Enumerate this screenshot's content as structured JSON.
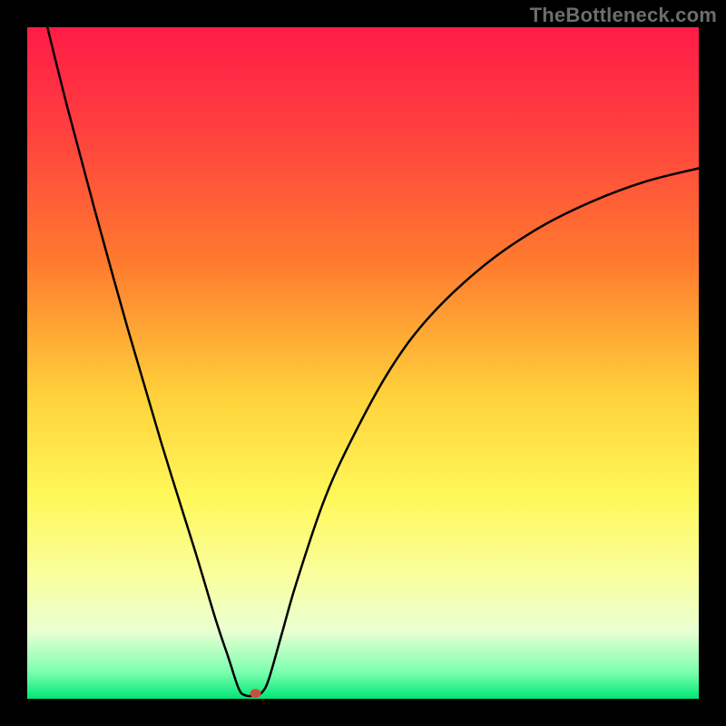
{
  "watermark": "TheBottleneck.com",
  "chart_data": {
    "type": "line",
    "title": "",
    "xlabel": "",
    "ylabel": "",
    "xlim": [
      0,
      100
    ],
    "ylim": [
      0,
      100
    ],
    "background_gradient": {
      "stops": [
        {
          "offset": 0.0,
          "color": "#ff1b47"
        },
        {
          "offset": 0.15,
          "color": "#ff3f3f"
        },
        {
          "offset": 0.35,
          "color": "#ff7a2f"
        },
        {
          "offset": 0.55,
          "color": "#ffd23a"
        },
        {
          "offset": 0.7,
          "color": "#fff85a"
        },
        {
          "offset": 0.82,
          "color": "#f9ffa0"
        },
        {
          "offset": 0.9,
          "color": "#e8ffd2"
        },
        {
          "offset": 0.96,
          "color": "#7dffb0"
        },
        {
          "offset": 1.0,
          "color": "#00e676"
        }
      ]
    },
    "series": [
      {
        "name": "bottleneck-curve",
        "color": "#000000",
        "stroke_width": 2.5,
        "points": [
          {
            "x": 3.0,
            "y": 100.0
          },
          {
            "x": 6.0,
            "y": 88.0
          },
          {
            "x": 10.0,
            "y": 73.0
          },
          {
            "x": 15.0,
            "y": 55.0
          },
          {
            "x": 20.0,
            "y": 38.0
          },
          {
            "x": 25.0,
            "y": 22.0
          },
          {
            "x": 28.0,
            "y": 12.0
          },
          {
            "x": 30.0,
            "y": 6.0
          },
          {
            "x": 31.5,
            "y": 1.5
          },
          {
            "x": 32.5,
            "y": 0.5
          },
          {
            "x": 34.0,
            "y": 0.5
          },
          {
            "x": 35.0,
            "y": 1.0
          },
          {
            "x": 36.0,
            "y": 3.0
          },
          {
            "x": 38.0,
            "y": 10.0
          },
          {
            "x": 40.0,
            "y": 17.0
          },
          {
            "x": 44.0,
            "y": 29.0
          },
          {
            "x": 48.0,
            "y": 38.0
          },
          {
            "x": 54.0,
            "y": 49.0
          },
          {
            "x": 60.0,
            "y": 57.0
          },
          {
            "x": 68.0,
            "y": 64.5
          },
          {
            "x": 76.0,
            "y": 70.0
          },
          {
            "x": 84.0,
            "y": 74.0
          },
          {
            "x": 92.0,
            "y": 77.0
          },
          {
            "x": 100.0,
            "y": 79.0
          }
        ]
      }
    ],
    "marker": {
      "x": 34.0,
      "y": 0.8,
      "rx": 6,
      "ry": 5,
      "color": "#c94f42"
    }
  }
}
